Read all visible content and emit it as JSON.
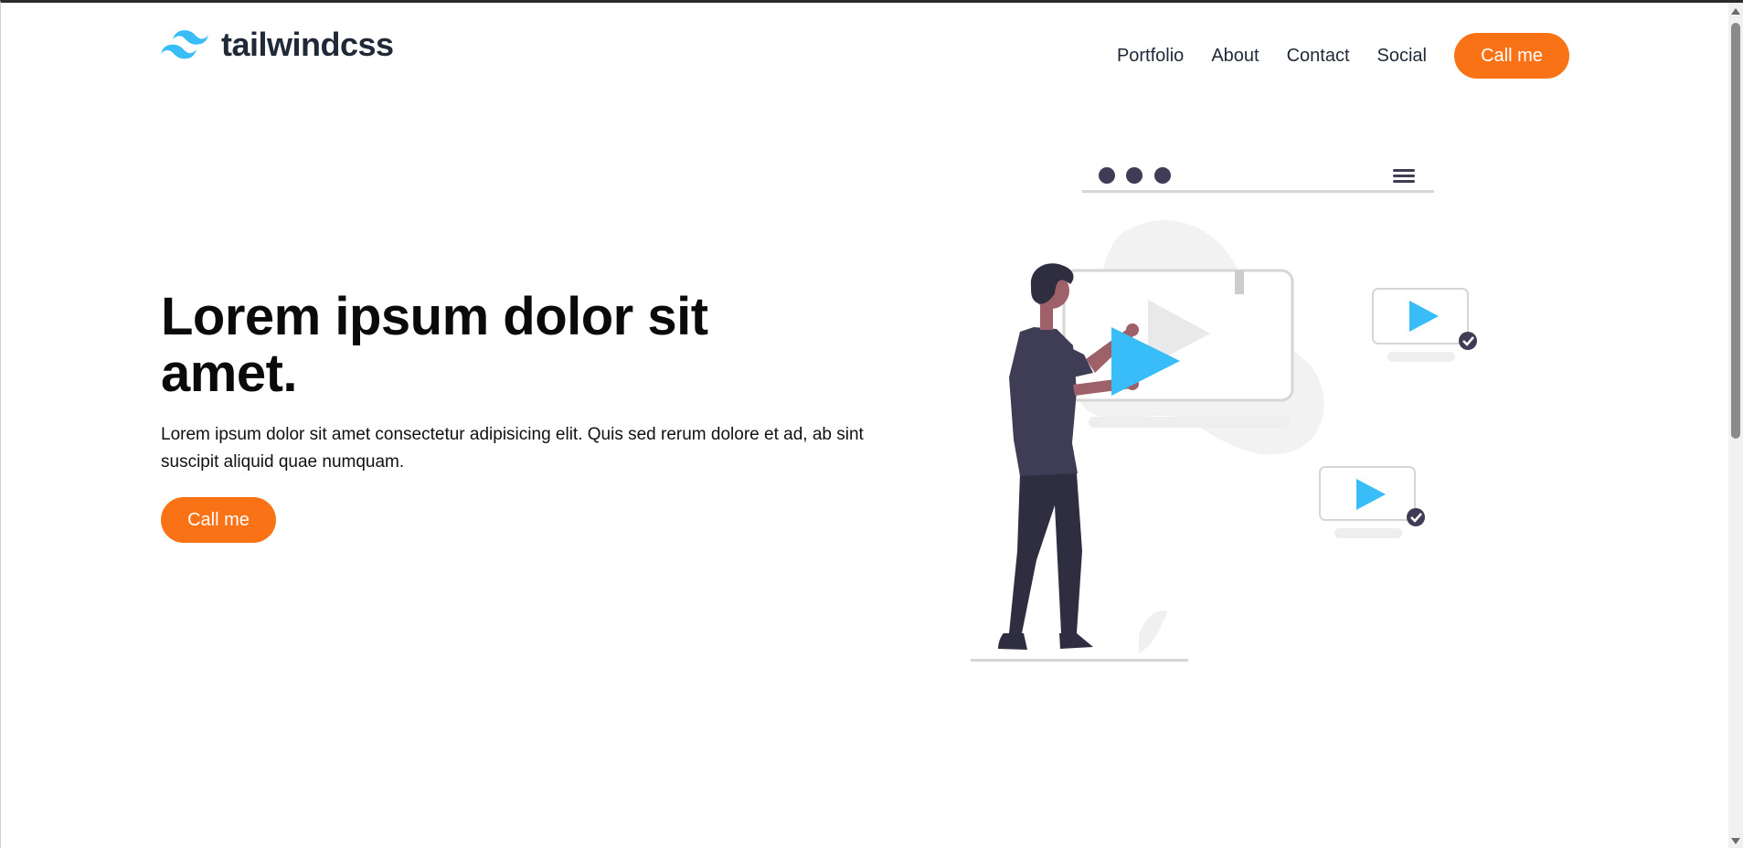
{
  "header": {
    "logo_text": "tailwindcss",
    "logo_icon": "tailwind-wave-icon",
    "nav": [
      {
        "label": "Portfolio"
      },
      {
        "label": "About"
      },
      {
        "label": "Contact"
      },
      {
        "label": "Social"
      }
    ],
    "cta_label": "Call me"
  },
  "hero": {
    "title": "Lorem ipsum dolor sit amet.",
    "text": "Lorem ipsum dolor sit amet consectetur adipisicing elit. Quis sed rerum dolore et ad, ab sint suscipit aliquid quae numquam.",
    "cta_label": "Call me"
  },
  "colors": {
    "accent": "#f97316",
    "logo_blue": "#38bdf8",
    "text_dark": "#1f2937",
    "illustration_dark": "#3f3d56",
    "play_blue": "#38bdf8"
  }
}
